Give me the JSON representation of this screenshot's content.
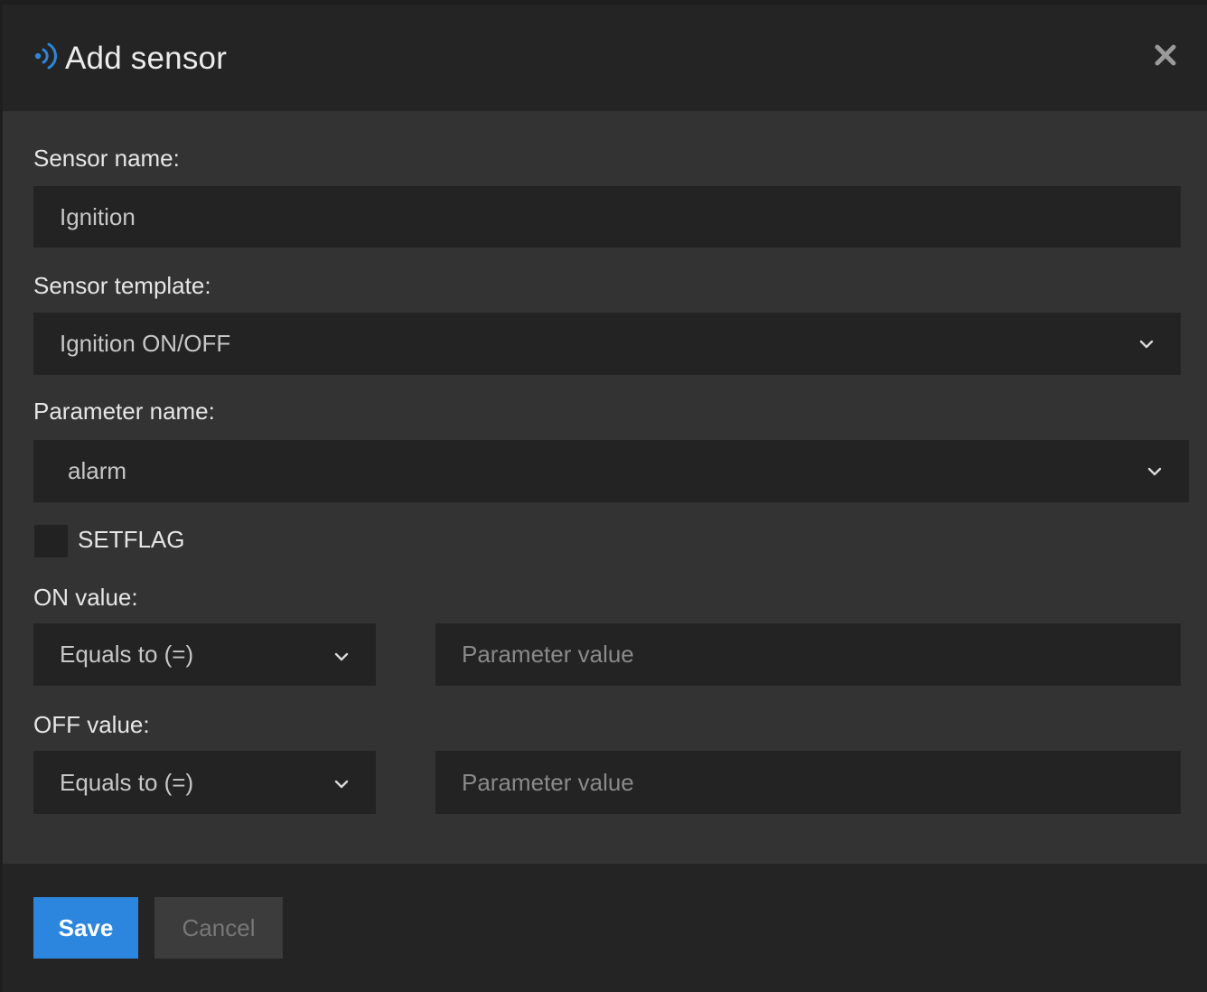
{
  "dialog": {
    "title": "Add sensor",
    "header_icon": "sensor-signal-icon",
    "close_icon": "close-icon",
    "accent_color": "#2d86dd"
  },
  "form": {
    "sensor_name": {
      "label": "Sensor name:",
      "value": "Ignition"
    },
    "sensor_template": {
      "label": "Sensor template:",
      "selected": "Ignition ON/OFF"
    },
    "parameter_name": {
      "label": "Parameter name:",
      "selected": "alarm"
    },
    "setflag": {
      "label": "SETFLAG",
      "checked": false
    },
    "on_value": {
      "label": "ON value:",
      "operator": "Equals to (=)",
      "placeholder": "Parameter value"
    },
    "off_value": {
      "label": "OFF value:",
      "operator": "Equals to (=)",
      "placeholder": "Parameter value"
    }
  },
  "footer": {
    "save_label": "Save",
    "cancel_label": "Cancel"
  }
}
